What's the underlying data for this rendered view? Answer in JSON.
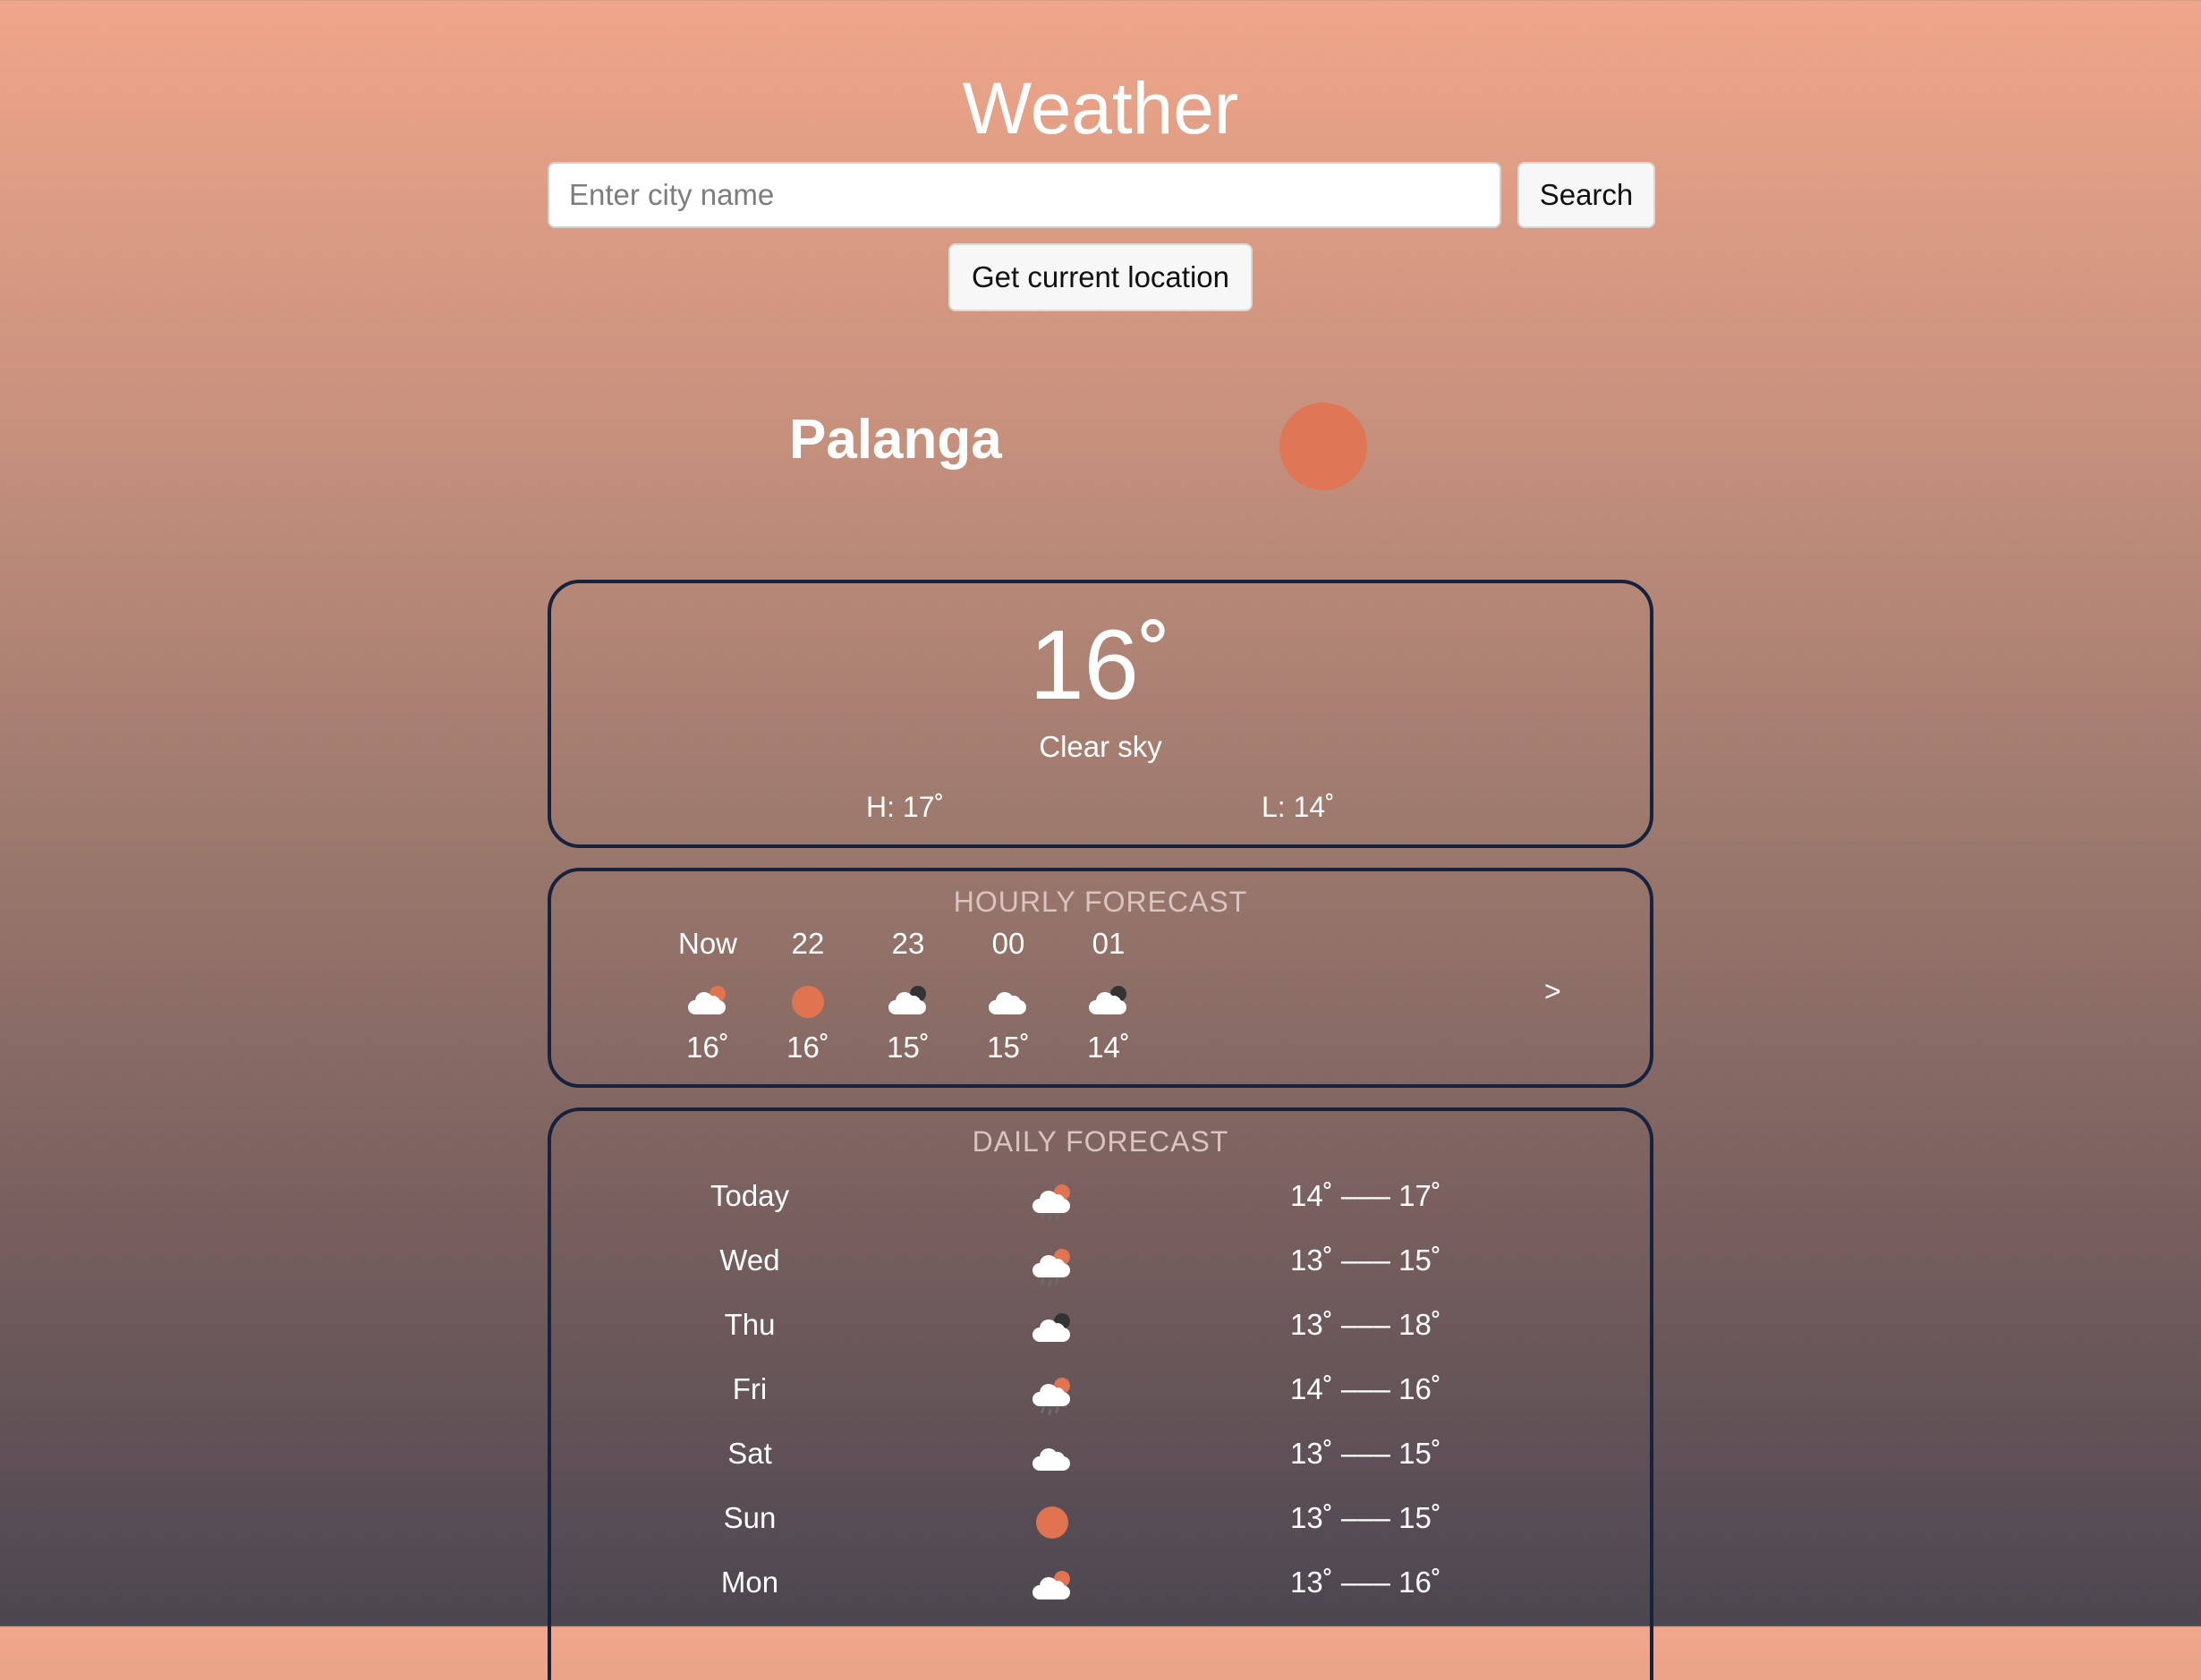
{
  "header": {
    "title": "Weather",
    "search_placeholder": "Enter city name",
    "search_value": "",
    "search_label": "Search",
    "location_label": "Get current location"
  },
  "current": {
    "city": "Palanga",
    "temperature": "16˚",
    "condition": "Clear sky",
    "high": "H: 17˚",
    "low": "L: 14˚",
    "icon": "sun-icon"
  },
  "hourly": {
    "title": "HOURLY FORECAST",
    "next_label": ">",
    "items": [
      {
        "time": "Now",
        "icon": "partly-cloudy-day-icon",
        "temp": "16˚"
      },
      {
        "time": "22",
        "icon": "sun-icon",
        "temp": "16˚"
      },
      {
        "time": "23",
        "icon": "partly-cloudy-night-icon",
        "temp": "15˚"
      },
      {
        "time": "00",
        "icon": "cloud-icon",
        "temp": "15˚"
      },
      {
        "time": "01",
        "icon": "partly-cloudy-night-icon",
        "temp": "14˚"
      }
    ]
  },
  "daily": {
    "title": "DAILY FORECAST",
    "items": [
      {
        "day": "Today",
        "icon": "rain-sun-icon",
        "range": "14˚ ––– 17˚"
      },
      {
        "day": "Wed",
        "icon": "rain-sun-icon",
        "range": "13˚ ––– 15˚"
      },
      {
        "day": "Thu",
        "icon": "partly-cloudy-night-icon",
        "range": "13˚ ––– 18˚"
      },
      {
        "day": "Fri",
        "icon": "rain-sun-icon",
        "range": "14˚ ––– 16˚"
      },
      {
        "day": "Sat",
        "icon": "cloud-icon",
        "range": "13˚ ––– 15˚"
      },
      {
        "day": "Sun",
        "icon": "sun-icon",
        "range": "13˚ ––– 15˚"
      },
      {
        "day": "Mon",
        "icon": "partly-cloudy-day-icon",
        "range": "13˚ ––– 16˚"
      }
    ]
  },
  "colors": {
    "accent_sun": "#e07350",
    "card_border": "#15233f",
    "section_title": "#d9c4c0"
  }
}
